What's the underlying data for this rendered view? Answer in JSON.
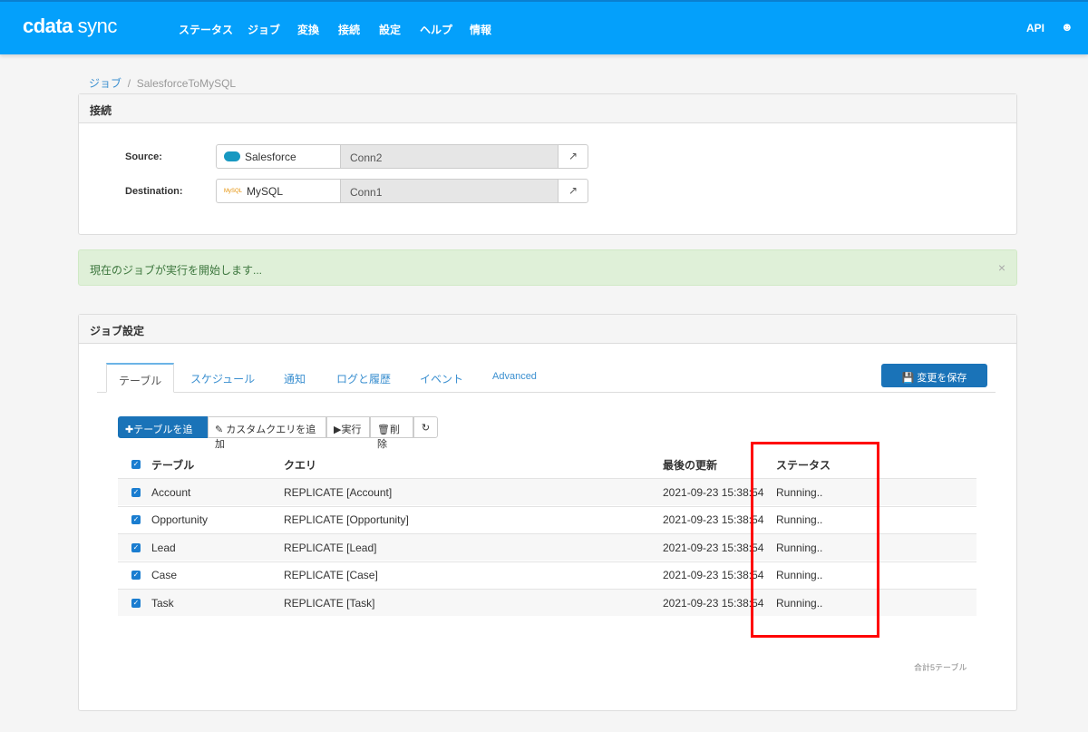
{
  "header": {
    "logo_a": "cdata",
    "logo_b": "sync",
    "nav": [
      "ステータス",
      "ジョブ",
      "変換",
      "接続",
      "設定",
      "ヘルプ",
      "情報"
    ],
    "api": "API"
  },
  "breadcrumb": {
    "parent": "ジョブ",
    "current": "SalesforceToMySQL"
  },
  "connection": {
    "title": "接続",
    "source_label": "Source:",
    "source_type": "Salesforce",
    "source_conn": "Conn2",
    "dest_label": "Destination:",
    "dest_type": "MySQL",
    "dest_conn": "Conn1"
  },
  "alert": {
    "text": "現在のジョブが実行を開始します...",
    "close": "×"
  },
  "job": {
    "title": "ジョブ設定",
    "tabs": [
      "テーブル",
      "スケジュール",
      "通知",
      "ログと履歴",
      "イベント",
      "Advanced"
    ],
    "save": "変更を保存",
    "toolbar": {
      "add_table": "テーブルを追加",
      "add_query": "カスタムクエリを追加",
      "run": "実行",
      "delete": "削除"
    },
    "columns": [
      "テーブル",
      "クエリ",
      "最後の更新",
      "ステータス"
    ],
    "rows": [
      {
        "table": "Account",
        "query": "REPLICATE [Account]",
        "updated": "2021-09-23 15:38:54",
        "status": "Running.."
      },
      {
        "table": "Opportunity",
        "query": "REPLICATE [Opportunity]",
        "updated": "2021-09-23 15:38:54",
        "status": "Running.."
      },
      {
        "table": "Lead",
        "query": "REPLICATE [Lead]",
        "updated": "2021-09-23 15:38:54",
        "status": "Running.."
      },
      {
        "table": "Case",
        "query": "REPLICATE [Case]",
        "updated": "2021-09-23 15:38:54",
        "status": "Running.."
      },
      {
        "table": "Task",
        "query": "REPLICATE [Task]",
        "updated": "2021-09-23 15:38:54",
        "status": "Running.."
      }
    ],
    "total": "合計5テーブル"
  }
}
